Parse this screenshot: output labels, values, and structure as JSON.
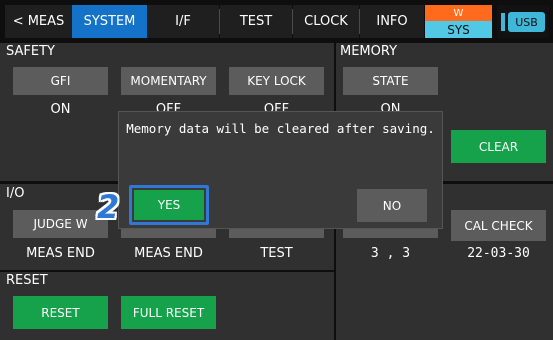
{
  "tabs": {
    "meas": "< MEAS",
    "system": "SYSTEM",
    "if": "I/F",
    "test": "TEST",
    "clock": "CLOCK",
    "info": "INFO"
  },
  "status": {
    "w_label": "W",
    "sys_label": "SYS",
    "usb_label": "USB"
  },
  "safety": {
    "title": "SAFETY",
    "gfi_label": "GFI",
    "gfi_value": "ON",
    "momentary_label": "MOMENTARY",
    "momentary_value": "OFF",
    "keylock_label": "KEY LOCK",
    "keylock_value": "OFF"
  },
  "memory": {
    "title": "MEMORY",
    "state_label": "STATE",
    "state_value": "ON",
    "clear_label": "CLEAR"
  },
  "io": {
    "title": "I/O",
    "judge_label": "JUDGE W",
    "judge_value": "MEAS END",
    "col2_value": "MEAS END",
    "col3_value": "TEST",
    "col4_value": "3 , 3",
    "calcheck_label": "CAL CHECK",
    "calcheck_value": "22-03-30"
  },
  "reset": {
    "title": "RESET",
    "reset_label": "RESET",
    "full_reset_label": "FULL RESET"
  },
  "dialog": {
    "message": "Memory data will be cleared after saving.",
    "yes_label": "YES",
    "no_label": "NO"
  },
  "callout": {
    "step_number": "2"
  },
  "colors": {
    "accent_blue": "#1473c9",
    "green": "#16a24b",
    "orange": "#ff6a1c",
    "cyan": "#50c8e6"
  }
}
